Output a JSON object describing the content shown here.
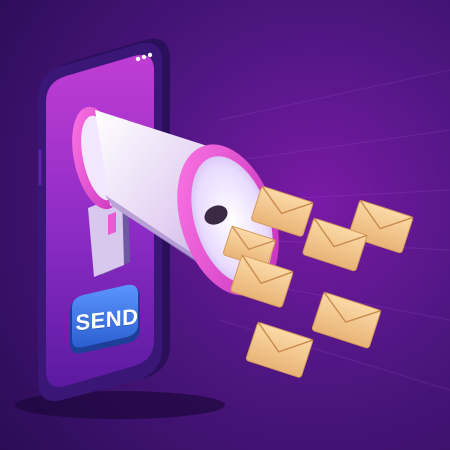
{
  "illustration": {
    "send_button_label": "SEND",
    "colors": {
      "background_dark": "#2a0c55",
      "background_mid": "#4d1680",
      "background_glow": "#7a1aa6",
      "phone_body": "#3a1676",
      "phone_screen_top": "#c03dd4",
      "phone_screen_bottom": "#5b1aa0",
      "megaphone_body": "#e9d7f6",
      "megaphone_ring": "#e544d3",
      "send_button": "#3b74e6",
      "envelope": "#f3c98e"
    },
    "icons": [
      "smartphone-icon",
      "megaphone-icon",
      "envelope-icon"
    ]
  }
}
